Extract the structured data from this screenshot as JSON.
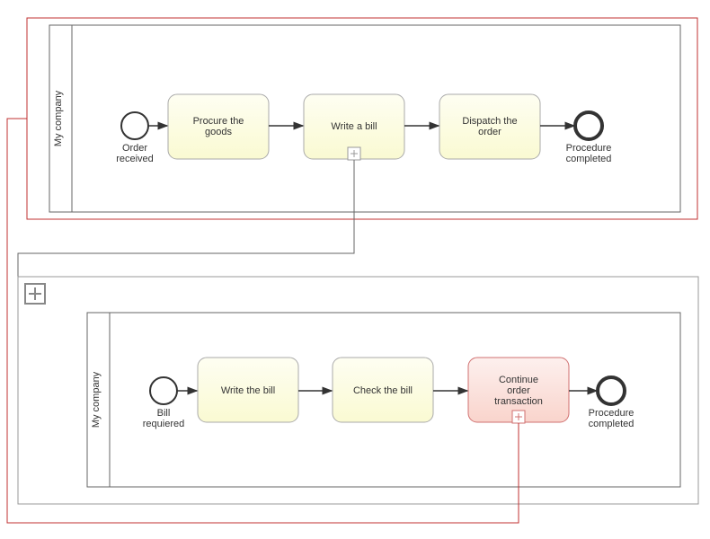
{
  "pool1": {
    "lane_label": "My company",
    "start_label": "Order\nreceived",
    "end_label": "Procedure\ncompleted",
    "tasks": [
      {
        "label": "Procure the\ngoods"
      },
      {
        "label": "Write a bill"
      },
      {
        "label": "Dispatch the\norder"
      }
    ]
  },
  "pool2": {
    "lane_label": "My company",
    "start_label": "Bill\nrequiered",
    "end_label": "Procedure\ncompleted",
    "tasks": [
      {
        "label": "Write the bill"
      },
      {
        "label": "Check the bill"
      },
      {
        "label": "Continue\norder\ntransaction"
      }
    ]
  }
}
